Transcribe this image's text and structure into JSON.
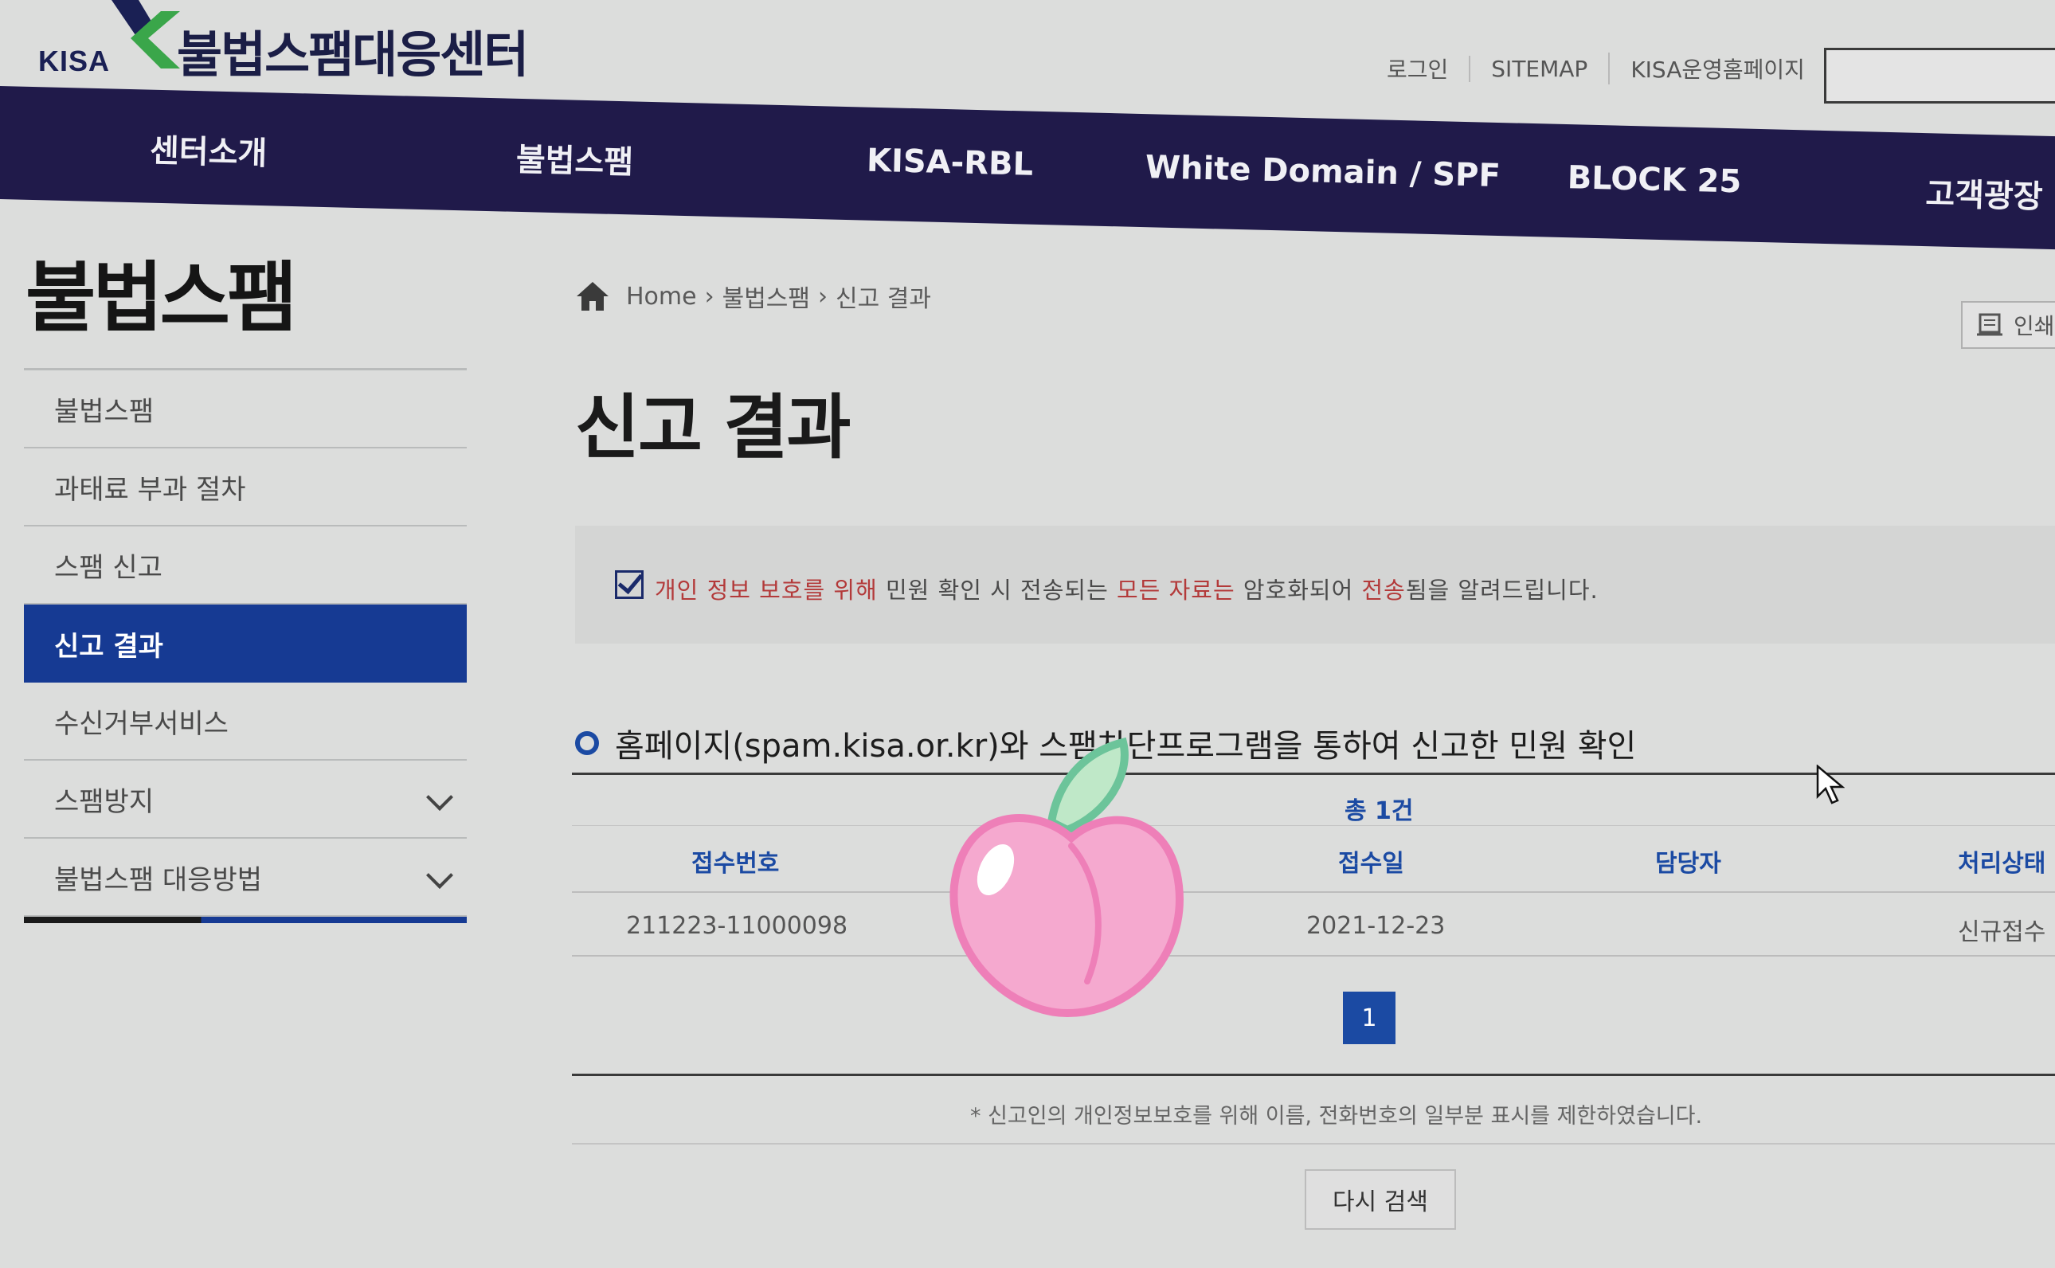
{
  "header": {
    "logo_text": "KISA",
    "site_title": "불법스팸대응센터",
    "util_nav": [
      "로그인",
      "SITEMAP",
      "KISA운영홈페이지"
    ]
  },
  "gnb": [
    "센터소개",
    "불법스팸",
    "KISA-RBL",
    "White Domain / SPF",
    "BLOCK 25",
    "고객광장"
  ],
  "sidebar": {
    "title": "불법스팸",
    "items": [
      {
        "label": "불법스팸"
      },
      {
        "label": "과태료 부과 절차"
      },
      {
        "label": "스팸 신고"
      },
      {
        "label": "신고 결과"
      },
      {
        "label": "수신거부서비스"
      },
      {
        "label": "스팸방지"
      },
      {
        "label": "불법스팸 대응방법"
      }
    ]
  },
  "breadcrumb": [
    "Home",
    "불법스팸",
    "신고 결과"
  ],
  "print_label": "인쇄",
  "page_title": "신고 결과",
  "notice": {
    "part1": "개인 정보 보호를 위해",
    "part2": " 민원 확인 시 전송되는 ",
    "part3": "모든 자료는",
    "part4": " 암호화되어 ",
    "part5": "전송",
    "part6": "됨을 알려드립니다."
  },
  "section_heading": "홈페이지(spam.kisa.or.kr)와 스팸차단프로그램을 통하여 신고한 민원 확인",
  "table": {
    "total": "총 1건",
    "headers": [
      "접수번호",
      "접수일",
      "담당자",
      "처리상태"
    ],
    "rows": [
      {
        "receipt_no": "211223-11000098",
        "date": "2021-12-23",
        "manager": "",
        "status": "신규접수"
      }
    ]
  },
  "pager": {
    "current": "1"
  },
  "privacy_note": "* 신고인의 개인정보보호를 위해 이름, 전화번호의 일부분 표시를 제한하였습니다.",
  "research_button": "다시 검색",
  "colors": {
    "nav_bg": "#201a4a",
    "active_bg": "#163a93",
    "accent_blue": "#1b4aa3",
    "notice_red": "#b33a3a"
  }
}
